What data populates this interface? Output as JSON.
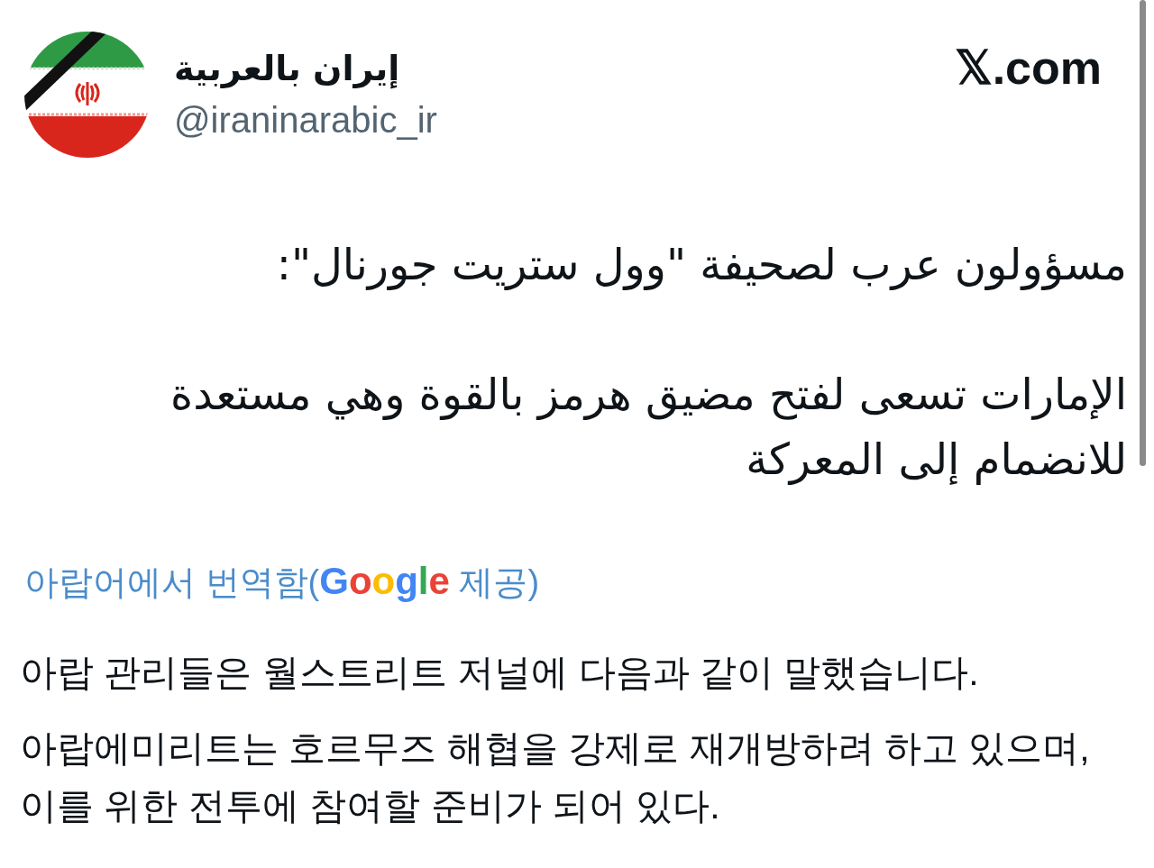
{
  "author": {
    "display_name": "إيران بالعربية",
    "handle": "@iraninarabic_ir"
  },
  "site_logo": "𝕏.com",
  "post": {
    "paragraphs": [
      "مسؤولون عرب لصحيفة \"وول ستريت جورنال\":",
      "الإمارات تسعى لفتح مضيق هرمز بالقوة وهي مستعدة للانضمام إلى المعركة"
    ]
  },
  "translation": {
    "label": "아랍어에서 번역함(",
    "provider_logo": "Google",
    "label_suffix": " 제공)",
    "paragraphs": [
      "아랍 관리들은 월스트리트 저널에 다음과 같이 말했습니다.",
      "아랍에미리트는 호르무즈 해협을 강제로 재개방하려 하고 있으며, 이를 위한 전투에 참여할 준비가 되어 있다."
    ]
  }
}
